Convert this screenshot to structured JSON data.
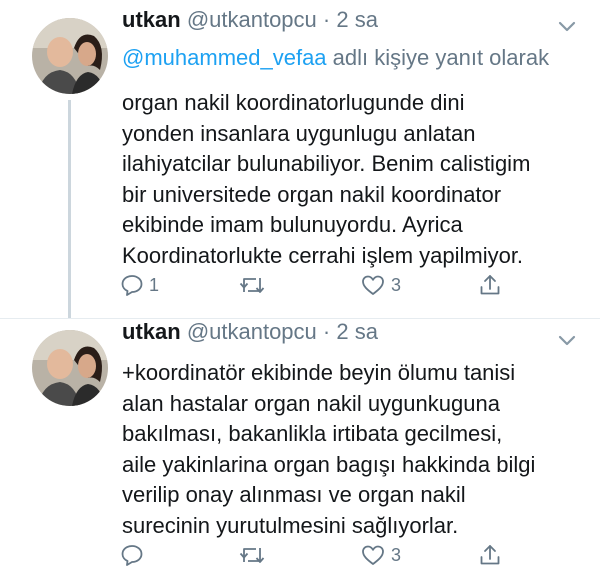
{
  "tweets": [
    {
      "name": "utkan",
      "handle": "@utkantopcu",
      "separator": "·",
      "time": "2 sa",
      "reply_mention": "@muhammed_vefaa",
      "reply_suffix": "adlı kişiye yanıt olarak",
      "lines": [
        "organ nakil koordinatorlugunde  dini",
        "yonden insanlara uygunlugu anlatan",
        "ilahiyatcilar bulunabiliyor. Benim calistigim",
        "bir universitede organ nakil koordinator",
        "ekibinde imam bulunuyordu. Ayrica",
        "Koordinatorlukte cerrahi işlem yapilmiyor."
      ],
      "reply_count": "1",
      "retweet_count": "",
      "like_count": "3"
    },
    {
      "name": "utkan",
      "handle": "@utkantopcu",
      "separator": "·",
      "time": "2 sa",
      "lines": [
        "+koordinatör ekibinde beyin ölumu tanisi",
        "alan hastalar organ nakil uygunkuguna",
        "bakılması,  bakanlikla irtibata gecilmesi,",
        "aile yakinlarina organ bagışı hakkinda bilgi",
        "verilip onay alınması ve organ nakil",
        "surecinin yurutulmesini sağlıyorlar."
      ],
      "reply_count": "",
      "retweet_count": "",
      "like_count": "3"
    }
  ],
  "icons": {
    "reply": "reply-icon",
    "retweet": "retweet-icon",
    "like": "heart-icon",
    "share": "share-icon",
    "more": "chevron-down-icon"
  },
  "colors": {
    "text": "#14171a",
    "secondary": "#657786",
    "link": "#1da1f2",
    "divider": "#e6ecf0",
    "thread_line": "#ccd6dd"
  }
}
